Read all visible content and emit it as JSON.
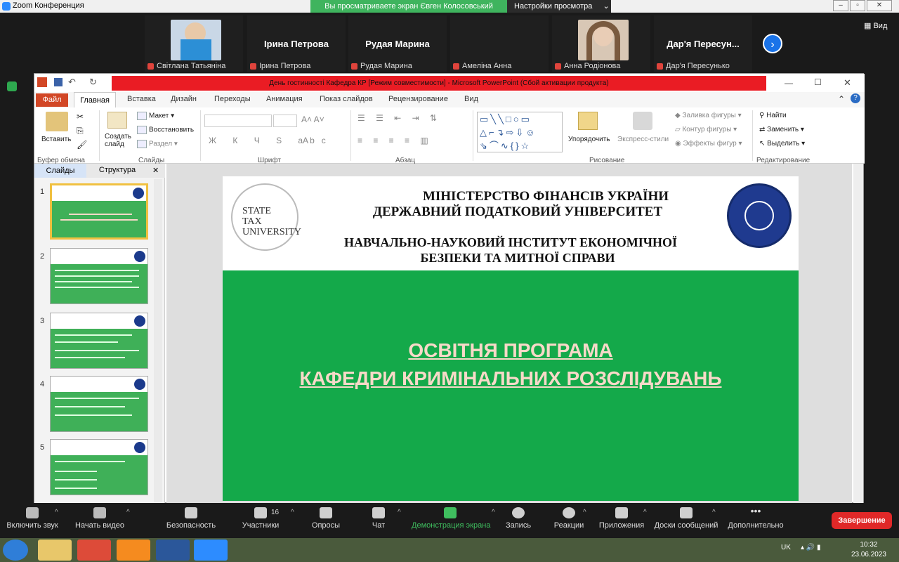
{
  "zoom": {
    "window_title": "Zoom Конференция",
    "share_banner": "Вы просматриваете экран Євген Колосовський",
    "view_options": "Настройки просмотра",
    "view_label": "Вид",
    "participants": [
      {
        "tile_name": "",
        "label": "Світлана Татьяніна"
      },
      {
        "tile_name": "Ірина Петрова",
        "label": "Ірина Петрова"
      },
      {
        "tile_name": "Рудая Марина",
        "label": "Рудая Марина"
      },
      {
        "tile_name": "",
        "label": "Амеліна Анна"
      },
      {
        "tile_name": "",
        "label": "Анна Родіонова"
      },
      {
        "tile_name": "Дар'я  Пересун...",
        "label": "Дар'я Пересунько"
      }
    ],
    "toolbar": {
      "mute": "Включить звук",
      "video": "Начать видео",
      "security": "Безопасность",
      "participants": "Участники",
      "participants_count": "16",
      "polls": "Опросы",
      "chat": "Чат",
      "share": "Демонстрация экрана",
      "record": "Запись",
      "reactions": "Реакции",
      "apps": "Приложения",
      "whiteboards": "Доски сообщений",
      "more": "Дополнительно",
      "end": "Завершение"
    }
  },
  "ppt": {
    "title": "День гостинності  Кафедра КР [Режим совместимости]  -  Microsoft PowerPoint (Сбой активации продукта)",
    "tabs": [
      "Файл",
      "Главная",
      "Вставка",
      "Дизайн",
      "Переходы",
      "Анимация",
      "Показ слайдов",
      "Рецензирование",
      "Вид"
    ],
    "ribbon": {
      "paste": "Вставить",
      "clipboard_group": "Буфер обмена",
      "new_slide": "Создать слайд",
      "layout": "Макет",
      "reset": "Восстановить",
      "section": "Раздел",
      "slides_group": "Слайды",
      "font_group": "Шрифт",
      "paragraph_group": "Абзац",
      "arrange": "Упорядочить",
      "quick_styles": "Экспресс-стили",
      "shape_fill": "Заливка фигуры",
      "shape_outline": "Контур фигуры",
      "shape_effects": "Эффекты фигур",
      "drawing_group": "Рисование",
      "find": "Найти",
      "replace": "Заменить",
      "select": "Выделить",
      "editing_group": "Редактирование"
    },
    "pane_tabs": {
      "slides": "Слайды",
      "outline": "Структура"
    },
    "thumb_numbers": [
      "1",
      "2",
      "3",
      "4",
      "5"
    ],
    "slide": {
      "stamp": [
        "STATE",
        "TAX",
        "UNIVERSITY"
      ],
      "line1": "МІНІСТЕРСТВО ФІНАНСІВ УКРАЇНИ",
      "line2": "ДЕРЖАВНИЙ  ПОДАТКОВИЙ  УНІВЕРСИТЕТ",
      "line3": "НАВЧАЛЬНО-НАУКОВИЙ ІНСТИТУТ ЕКОНОМІЧНОЇ",
      "line4": "БЕЗПЕКИ ТА МИТНОЇ СПРАВИ",
      "program1": "ОСВІТНЯ ПРОГРАМА",
      "program2": "КАФЕДРИ КРИМІНАЛЬНИХ РОЗСЛІДУВАНЬ"
    }
  },
  "taskbar": {
    "lang": "UK",
    "time": "10:32",
    "date": "23.06.2023"
  },
  "colors": {
    "slide_green": "#14a94a",
    "title_red": "#ea1c24",
    "zoom_green": "#3fb45e"
  }
}
